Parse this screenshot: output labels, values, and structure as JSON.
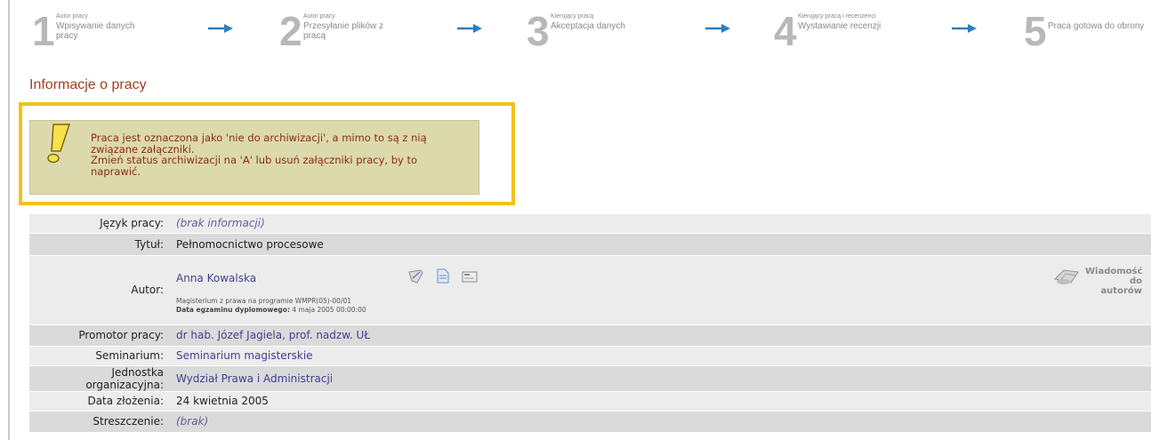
{
  "steps": [
    {
      "number": "1",
      "small": "Autor pracy",
      "big": "Wpisywanie danych pracy"
    },
    {
      "number": "2",
      "small": "Autor pracy",
      "big": "Przesyłanie plików z pracą"
    },
    {
      "number": "3",
      "small": "Kierujący pracą",
      "big": "Akceptacja danych"
    },
    {
      "number": "4",
      "small": "Kierujący pracą i recenzenci",
      "big": "Wystawianie recenzji"
    },
    {
      "number": "5",
      "small": "",
      "big": "Praca gotowa do obrony"
    }
  ],
  "section_title": "Informacje o pracy",
  "warning": {
    "line1": "Praca jest oznaczona jako 'nie do archiwizacji', a mimo to są z nią związane załączniki.",
    "line2": "Zmień status archiwizacji na 'A' lub usuń załączniki pracy, by to naprawić."
  },
  "fields": {
    "language": {
      "label": "Język pracy:",
      "value": "(brak informacji)"
    },
    "title": {
      "label": "Tytuł:",
      "value": "Pełnomocnictwo procesowe"
    },
    "author": {
      "label": "Autor:",
      "name": "Anna Kowalska",
      "program": "Magisterium z prawa na programie WMPR(05)-00/01",
      "exam_label": "Data egzaminu dyplomowego:",
      "exam_value": "4 maja 2005 00:00:00",
      "message_label": "Wiadomość do autorów"
    },
    "promotor": {
      "label": "Promotor pracy:",
      "value": "dr hab. Józef Jagiela, prof. nadzw. UŁ"
    },
    "seminar": {
      "label": "Seminarium:",
      "value": "Seminarium magisterskie"
    },
    "unit": {
      "label": "Jednostka organizacyjna:",
      "value": "Wydział Prawa i Administracji"
    },
    "submission_date": {
      "label": "Data złożenia:",
      "value": "24 kwietnia 2005"
    },
    "abstract": {
      "label": "Streszczenie:",
      "value": "(brak)"
    }
  },
  "colors": {
    "accent_title": "#a23f1c",
    "warning_bg": "#dcd9ad",
    "highlight": "#f2c21b",
    "arrow": "#2a7fc1",
    "link": "#3f3f8f"
  },
  "icons": [
    "arrow-right-icon",
    "exclamation-icon",
    "edit-icon",
    "document-icon",
    "card-icon",
    "mail-icon"
  ]
}
